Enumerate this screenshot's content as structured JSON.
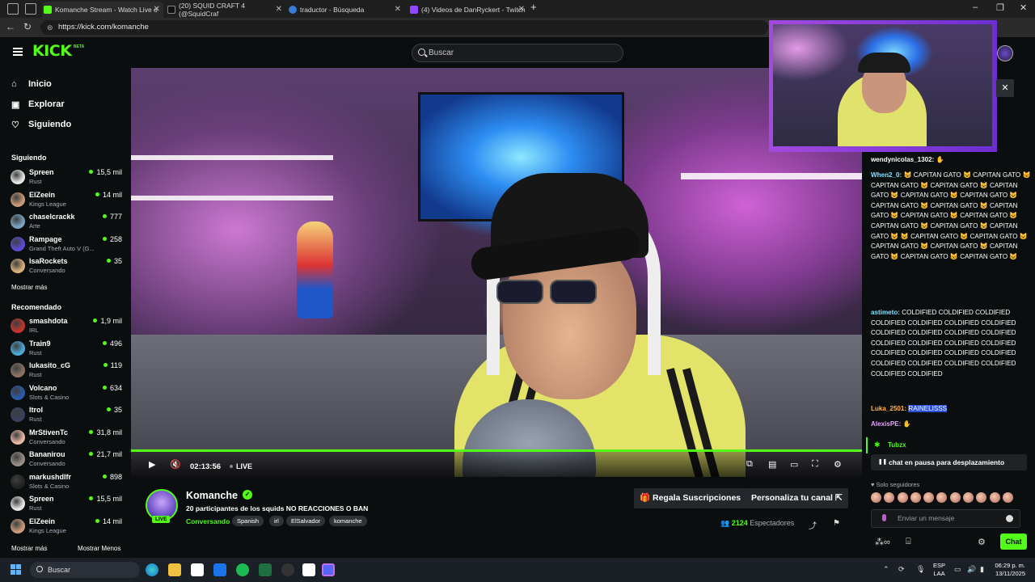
{
  "browser": {
    "tabs": [
      {
        "title": "Komanche Stream - Watch Live o",
        "active": true
      },
      {
        "title": "(20) SQUID CRAFT 4 (@SquidCraf",
        "active": false
      },
      {
        "title": "traductor - Búsqueda",
        "active": false
      },
      {
        "title": "(4) Videos de DanRyckert - Twitch",
        "active": false
      }
    ],
    "new_tab": "+",
    "url": "https://kick.com/komanche"
  },
  "header": {
    "logo": "KICK",
    "logo_badge": "BETA",
    "search_placeholder": "Buscar"
  },
  "sidebar": {
    "nav": [
      {
        "label": "Inicio",
        "icon": "home-icon"
      },
      {
        "label": "Explorar",
        "icon": "explore-icon"
      },
      {
        "label": "Siguiendo",
        "icon": "heart-icon"
      }
    ],
    "following_title": "Siguiendo",
    "following": [
      {
        "name": "Spreen",
        "category": "Rust",
        "viewers": "15,5 mil",
        "color": "#e6e6e6"
      },
      {
        "name": "ElZeein",
        "category": "Kings League",
        "viewers": "14 mil",
        "color": "#c99a78"
      },
      {
        "name": "chaselcrackk",
        "category": "Arte",
        "viewers": "777",
        "color": "#7aa3c2"
      },
      {
        "name": "Rampage",
        "category": "Grand Theft Auto V (G...",
        "viewers": "258",
        "color": "#5f4bd6"
      },
      {
        "name": "IsaRockets",
        "category": "Conversando",
        "viewers": "35",
        "color": "#d8b07a"
      }
    ],
    "show_more": "Mostrar más",
    "recommended_title": "Recomendado",
    "recommended": [
      {
        "name": "smashdota",
        "category": "IRL",
        "viewers": "1,9 mil",
        "color": "#c4342d"
      },
      {
        "name": "Train9",
        "category": "Rust",
        "viewers": "496",
        "color": "#4fa8d6"
      },
      {
        "name": "lukasito_cG",
        "category": "Rust",
        "viewers": "119",
        "color": "#8a7265"
      },
      {
        "name": "Volcano",
        "category": "Slots & Casino",
        "viewers": "634",
        "color": "#2a5ba8"
      },
      {
        "name": "ltrol",
        "category": "Rust",
        "viewers": "35",
        "color": "#3a3f5c"
      },
      {
        "name": "MrStivenTc",
        "category": "Conversando",
        "viewers": "31,8 mil",
        "color": "#e8b8a0"
      },
      {
        "name": "Bananirou",
        "category": "Conversando",
        "viewers": "21,7 mil",
        "color": "#9a8d88"
      },
      {
        "name": "markushdlfr",
        "category": "Slots & Casino",
        "viewers": "898",
        "color": "#222222"
      },
      {
        "name": "Spreen",
        "category": "Rust",
        "viewers": "15,5 mil",
        "color": "#e6e6e6"
      },
      {
        "name": "ElZeein",
        "category": "Kings League",
        "viewers": "14 mil",
        "color": "#c99a78"
      }
    ],
    "show_more_bottom": "Mostrar más",
    "show_less": "Mostrar Menos"
  },
  "player": {
    "timecode": "02:13:56",
    "live_label": "LIVE",
    "progress_fraction": 1.0
  },
  "stream": {
    "name": "Komanche",
    "live_badge": "LIVE",
    "title": "20 participantes de los squids NO REACCIONES O BAN",
    "category": "Conversando",
    "tags": [
      "Spanish",
      "irl",
      "ElSalvador",
      "komanche"
    ],
    "subscribe_button": "Regala Suscripciones",
    "customize_button": "Personaliza tu canal",
    "viewers_count": "2124",
    "viewers_label": "Espectadores"
  },
  "chat": {
    "messages": [
      {
        "user": "wendynicolas_1302:",
        "text": "",
        "color": "#ffffff"
      },
      {
        "user": "When2_0:",
        "text": "😺 CAPITAN GATO 😺 CAPITAN GATO 😺 CAPITAN GATO 😺 CAPITAN GATO 😺 CAPITAN GATO 😺 CAPITAN GATO 😺 CAPITAN GATO 😺 CAPITAN GATO 😺 CAPITAN GATO 😺 CAPITAN GATO 😺 CAPITAN GATO 😺 CAPITAN GATO 😺 CAPITAN GATO 😺 CAPITAN GATO 😺 CAPITAN GATO 😺 😺 CAPITAN GATO 😺 CAPITAN GATO 😺 CAPITAN GATO 😺 CAPITAN GATO 😺 CAPITAN GATO 😺 CAPITAN GATO 😺 CAPITAN GATO 😺",
        "color": "#7ee2ff"
      },
      {
        "user": "astimeto:",
        "text": "COLDIFIED COLDIFIED COLDIFIED COLDIFIED COLDIFIED COLDIFIED COLDIFIED COLDIFIED COLDIFIED COLDIFIED COLDIFIED COLDIFIED COLDIFIED COLDIFIED COLDIFIED COLDIFIED COLDIFIED COLDIFIED COLDIFIED COLDIFIED COLDIFIED COLDIFIED COLDIFIED COLDIFIED COLDIFIED",
        "color": "#7ee2ff"
      },
      {
        "user": "Luka_2501:",
        "text": "RAINELISSS",
        "color": "#ffb347"
      },
      {
        "user": "AlexisPE:",
        "text": "",
        "color": "#e8a0ff"
      }
    ],
    "pinned_user": "Tubzx",
    "pause_notice": "chat en pausa para desplazamiento",
    "followers_only": "Solo seguidores",
    "input_placeholder": "Enviar un mensaje",
    "send_button": "Chat"
  },
  "taskbar": {
    "search_placeholder": "Buscar",
    "language": "ESP",
    "language_sub": "LAA",
    "time": "06:29 p. m.",
    "date": "13/11/2025"
  },
  "colors": {
    "brand": "#53fc18",
    "background": "#0b0e0f"
  }
}
